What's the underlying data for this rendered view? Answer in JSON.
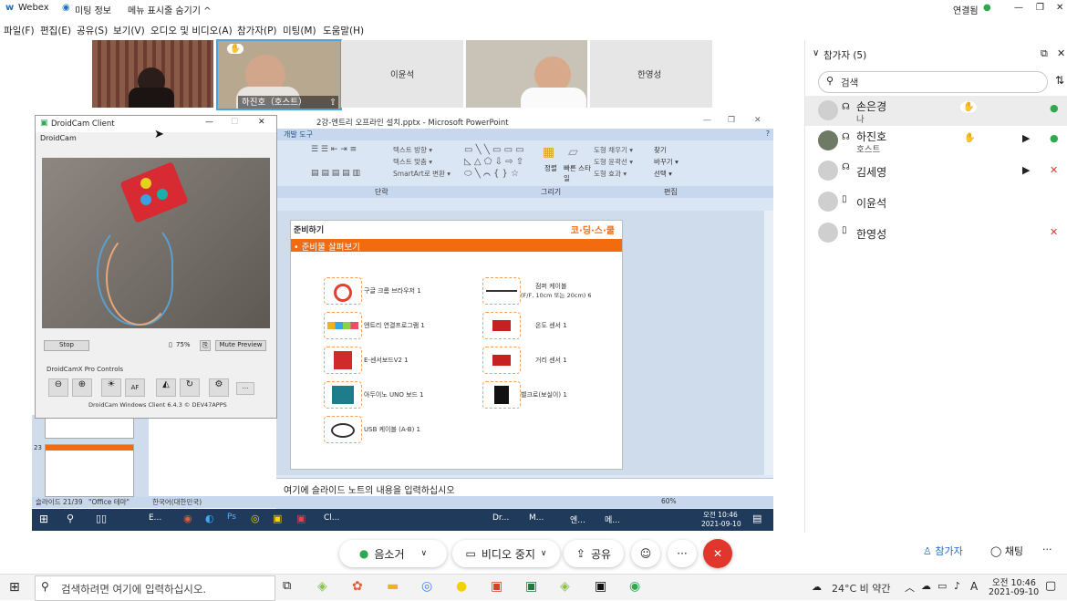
{
  "titlebar": {
    "app": "Webex",
    "meeting_info": "미팅 정보",
    "hide_menu": "메뉴 표시줄 숨기기 ^",
    "status": "연결됨",
    "min": "—",
    "restore": "❐",
    "close": "✕"
  },
  "menu": [
    "파일(F)",
    "편집(E)",
    "공유(S)",
    "보기(V)",
    "오디오 및 비디오(A)",
    "참가자(P)",
    "미팅(M)",
    "도움말(H)"
  ],
  "video": {
    "tile2_name": "하진호（호스트）",
    "tile3_name": "이윤석",
    "tile5_name": "한영성"
  },
  "ppt": {
    "title": "2강-엔트리 오프라인 설치.pptx - Microsoft PowerPoint",
    "tab": "개발 도구",
    "group_para": "단락",
    "group_draw": "그리기",
    "group_edit": "편집",
    "btn_find": "찾기",
    "btn_replace": "바꾸기 ▾",
    "btn_select": "선택 ▾",
    "btn_arrange": "정렬",
    "btn_quick": "빠른 스타일",
    "fill": "도형 채우기 ▾",
    "outline": "도형 윤곽선 ▾",
    "effect": "도형 효과 ▾",
    "text_dir": "텍스트 방향 ▾",
    "text_align": "텍스트 맞춤 ▾",
    "smartart": "SmartArt로 변환 ▾",
    "notes": "여기에 슬라이드 노트의 내용을 입력하십시오",
    "status_slide": "슬라이드 21/39",
    "status_theme": "\"Office 테마\"",
    "status_lang": "한국어(대한민국)",
    "zoom": "60%",
    "thumb_num": "23"
  },
  "slide": {
    "header_left": "준비하기",
    "brand": "코·딩·스·쿨",
    "subtitle": "• 준비물 살펴보기",
    "items_left": [
      "구글 크롬 브라우저 1",
      "엔트리 연결프로그램 1",
      "E-센서보드V2 1",
      "아두이노 UNO 보드 1",
      "USB 케이블 (A-B) 1"
    ],
    "items_right": [
      "점퍼 케이블",
      "(F/F, 10cm 또는 20cm) 6",
      "온도 센서 1",
      "거리 센서 1",
      "벨크로(보실이) 1"
    ]
  },
  "droidcam": {
    "title": "DroidCam Client",
    "menu": "DroidCam",
    "stop": "Stop",
    "battery": "75%",
    "mute": "Mute Preview",
    "pro": "DroidCamX Pro Controls",
    "af": "AF",
    "more": "...",
    "footer": "DroidCam Windows Client 6.4.3 © DEV47APPS"
  },
  "inner_task": {
    "e_label": "E...",
    "cl_label": "Cl...",
    "dr_label": "Dr...",
    "m_label": "M...",
    "en_label": "엔...",
    "me_label": "메...",
    "time": "오전 10:46",
    "date": "2021-09-10"
  },
  "panel": {
    "title": "참가자 (5)",
    "search_placeholder": "검색",
    "participants": [
      {
        "name": "손은경",
        "sub": "나"
      },
      {
        "name": "하진호",
        "sub": "호스트"
      },
      {
        "name": "김세영",
        "sub": ""
      },
      {
        "name": "이윤석",
        "sub": ""
      },
      {
        "name": "한영성",
        "sub": ""
      }
    ],
    "btn_participants": "참가자",
    "btn_chat": "채팅",
    "btn_more": "···"
  },
  "controls": {
    "mute": "음소거",
    "video": "비디오 중지",
    "share": "공유",
    "more": "···",
    "end": "✕"
  },
  "wintask": {
    "search": "검색하려면 여기에 입력하십시오.",
    "weather": "24°C  비 약간",
    "lang": "A",
    "time": "오전 10:46",
    "date": "2021-09-10"
  },
  "colors": {
    "accent_blue": "#1f6ec8",
    "end_red": "#e0362c",
    "mic_green": "#2fa84f",
    "slide_orange": "#f26b0f"
  }
}
